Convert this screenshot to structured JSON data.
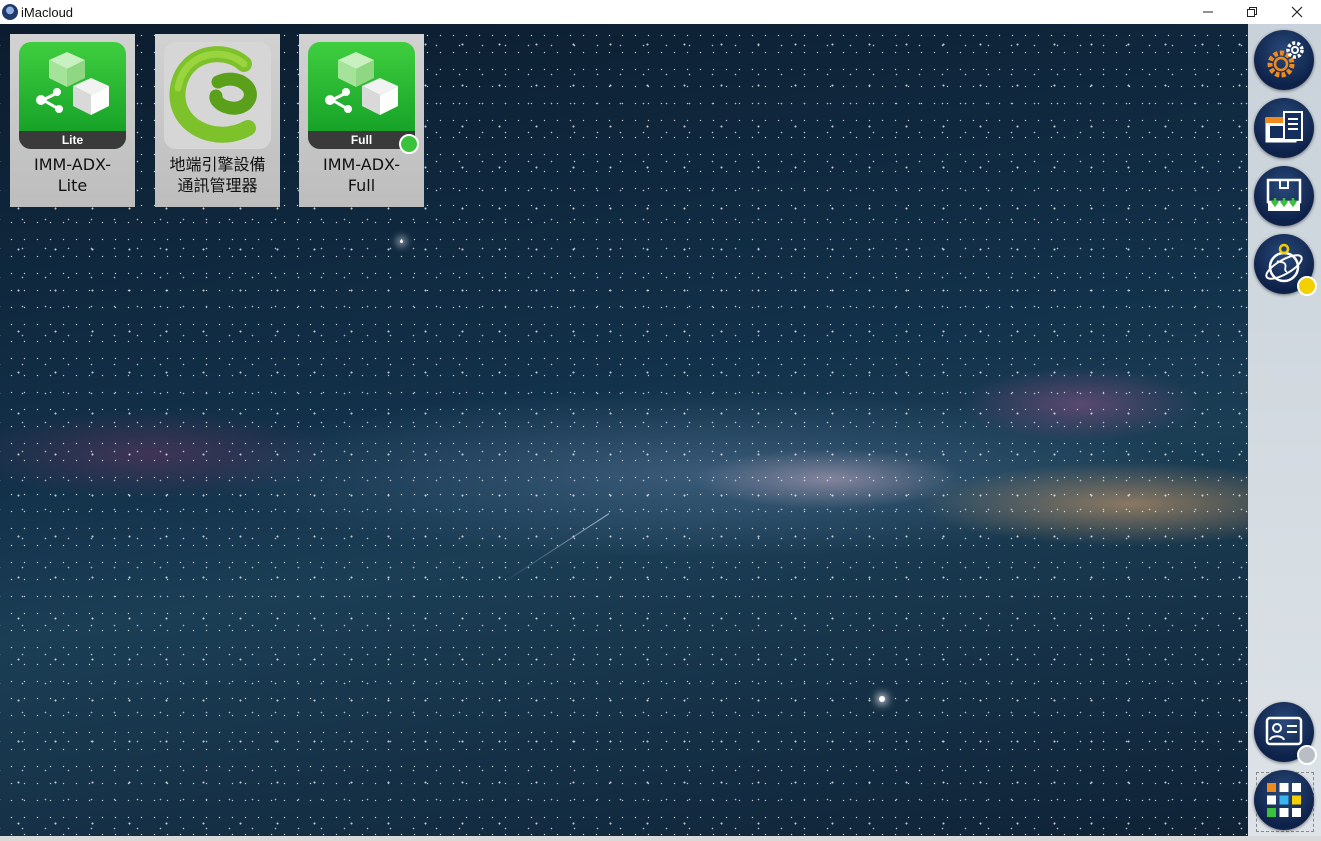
{
  "window": {
    "title": "iMacloud"
  },
  "apps": [
    {
      "label": "IMM-ADX-\nLite",
      "band": "Lite",
      "icon": "cubes-network-icon",
      "status": ""
    },
    {
      "label": "地端引擎設備\n通訊管理器",
      "band": "",
      "icon": "green-c-logo-icon",
      "status": ""
    },
    {
      "label": "IMM-ADX-\nFull",
      "band": "Full",
      "icon": "cubes-network-icon",
      "status": "running"
    }
  ],
  "sidebar": {
    "buttons": [
      {
        "name": "settings",
        "icon": "gears-icon"
      },
      {
        "name": "documents",
        "icon": "window-document-icon"
      },
      {
        "name": "download",
        "icon": "download-tray-icon"
      },
      {
        "name": "globe-connect",
        "icon": "globe-orbit-icon",
        "status_color": "#f5d000"
      },
      {
        "name": "account",
        "icon": "id-card-icon",
        "status_color": "#b8bec4"
      },
      {
        "name": "apps",
        "icon": "app-grid-icon"
      }
    ]
  },
  "colors": {
    "running": "#3ac23a",
    "warning": "#f5d000",
    "inactive": "#b8bec4",
    "sidebar_button": "#142e5e"
  }
}
